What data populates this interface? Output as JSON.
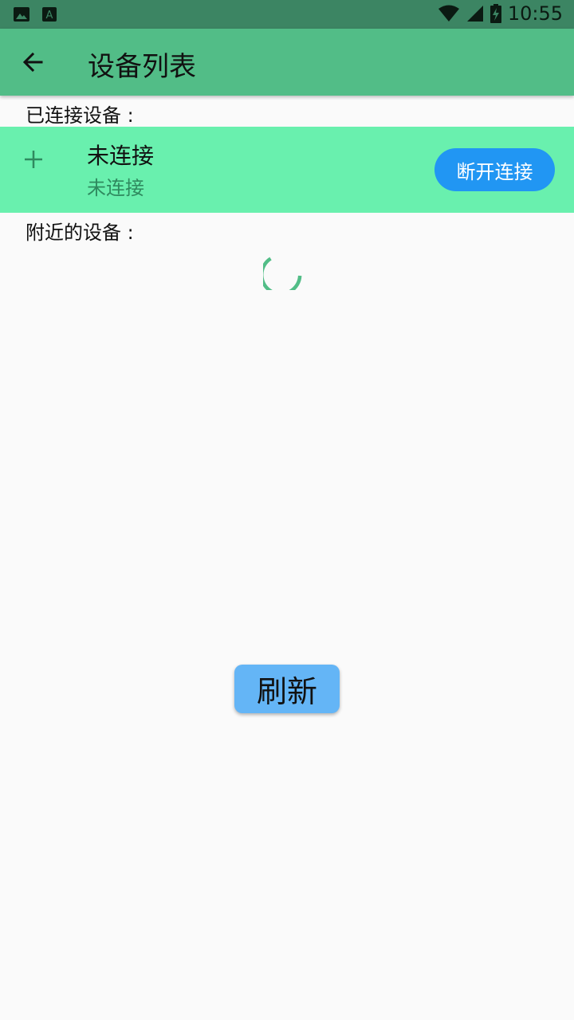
{
  "status_bar": {
    "time": "10:55",
    "left_icons": [
      "image-icon",
      "a-badge-icon"
    ],
    "right_icons": [
      "wifi-icon",
      "signal-icon",
      "battery-charging-icon"
    ]
  },
  "app_bar": {
    "back_icon": "arrow-left-icon",
    "title": "设备列表"
  },
  "connected_section": {
    "label": "已连接设备 :",
    "device": {
      "icon": "plus-icon",
      "name": "未连接",
      "subtitle": "未连接",
      "action_label": "断开连接"
    }
  },
  "nearby_section": {
    "label": "附近的设备 :"
  },
  "refresh_label": "刷新",
  "colors": {
    "status_bar": "#3c8563",
    "app_bar": "#52bd87",
    "connected_row": "#69f0ae",
    "disconnect_button": "#2196f3",
    "refresh_button": "#64b5f6",
    "spinner": "#52bd87"
  }
}
